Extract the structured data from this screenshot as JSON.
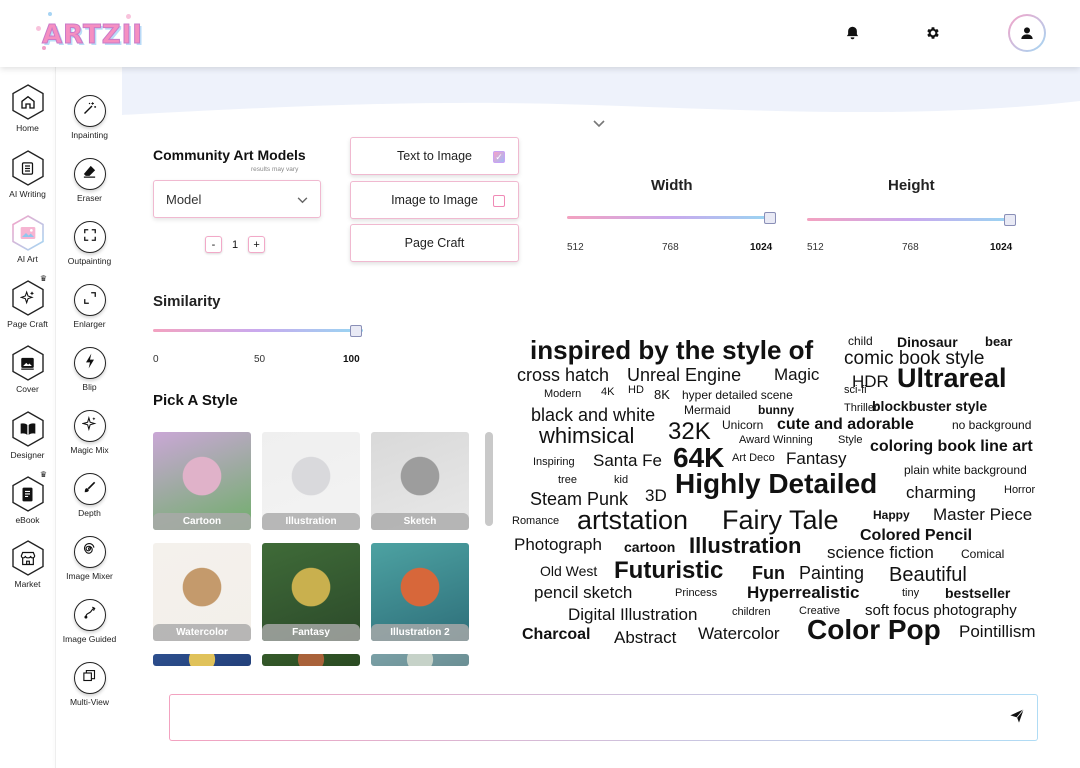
{
  "app": {
    "logo_text": "ARTZII"
  },
  "header": {
    "icons": [
      "bell-icon",
      "gear-icon",
      "user-icon"
    ]
  },
  "rail_primary": [
    {
      "label": "Home",
      "icon": "home-icon"
    },
    {
      "label": "AI Writing",
      "icon": "document-lines-icon"
    },
    {
      "label": "AI Art",
      "icon": "image-icon",
      "active": true
    },
    {
      "label": "Page Craft",
      "icon": "sparkles-icon",
      "crown": true
    },
    {
      "label": "Cover",
      "icon": "gallery-icon"
    },
    {
      "label": "Designer",
      "icon": "book-open-icon"
    },
    {
      "label": "eBook",
      "icon": "ebook-icon",
      "crown": true
    },
    {
      "label": "Market",
      "icon": "store-icon"
    }
  ],
  "rail_tools": [
    {
      "label": "Inpainting",
      "icon": "magic-wand-icon"
    },
    {
      "label": "Eraser",
      "icon": "eraser-icon"
    },
    {
      "label": "Outpainting",
      "icon": "expand-corners-icon"
    },
    {
      "label": "Enlarger",
      "icon": "enlarge-icon"
    },
    {
      "label": "Blip",
      "icon": "lightning-icon"
    },
    {
      "label": "Magic Mix",
      "icon": "sparkle-icon"
    },
    {
      "label": "Depth",
      "icon": "brush-icon"
    },
    {
      "label": "Image Mixer",
      "icon": "spiral-icon"
    },
    {
      "label": "Image Guided",
      "icon": "path-icon"
    },
    {
      "label": "Multi-View",
      "icon": "layers-icon"
    }
  ],
  "models": {
    "title": "Community Art Models",
    "note": "results may vary",
    "select_value": "Model",
    "count": "1",
    "minus": "-",
    "plus": "+"
  },
  "modes": [
    {
      "label": "Text to Image",
      "checked": true,
      "has_checkbox": true
    },
    {
      "label": "Image to Image",
      "checked": false,
      "has_checkbox": true
    },
    {
      "label": "Page Craft",
      "checked": false,
      "has_checkbox": false
    }
  ],
  "width": {
    "label": "Width",
    "min": "512",
    "mid": "768",
    "max": "1024",
    "value": 1024
  },
  "height": {
    "label": "Height",
    "min": "512",
    "mid": "768",
    "max": "1024",
    "value": 1024
  },
  "similarity": {
    "label": "Similarity",
    "min": "0",
    "mid": "50",
    "max": "100",
    "value": 100
  },
  "styles": {
    "title": "Pick A Style",
    "items": [
      {
        "label": "Cartoon",
        "bg": [
          "#caa7d6",
          "#e0b2c9",
          "#6fae6a"
        ]
      },
      {
        "label": "Illustration",
        "bg": [
          "#efefef",
          "#d9d9dc",
          "#f3f3f3"
        ]
      },
      {
        "label": "Sketch",
        "bg": [
          "#d9d9d9",
          "#9d9d9d",
          "#e8e8e8"
        ]
      },
      {
        "label": "Watercolor",
        "bg": [
          "#f4f1ec",
          "#c49a6c",
          "#f3efea"
        ]
      },
      {
        "label": "Fantasy",
        "bg": [
          "#3f6b38",
          "#c9b04e",
          "#2c4a2a"
        ]
      },
      {
        "label": "Illustration 2",
        "bg": [
          "#4da2a2",
          "#d7673a",
          "#2e6f7a"
        ]
      },
      {
        "label": "",
        "bg": [
          "#2d4f8e",
          "#e0c25a",
          "#23407a"
        ]
      },
      {
        "label": "",
        "bg": [
          "#355a2a",
          "#a9623a",
          "#2a4a22"
        ]
      },
      {
        "label": "",
        "bg": [
          "#7aa0a6",
          "#c6d2c8",
          "#6b8f94"
        ]
      }
    ]
  },
  "word_cloud": [
    {
      "t": "inspired by the style of",
      "s": 26,
      "w": 700
    },
    {
      "t": "child",
      "s": 12,
      "w": 400
    },
    {
      "t": "Dinosaur",
      "s": 14,
      "w": 700
    },
    {
      "t": "bear",
      "s": 13,
      "w": 700
    },
    {
      "t": "comic book style",
      "s": 19,
      "w": 400
    },
    {
      "t": "cross hatch",
      "s": 18,
      "w": 400
    },
    {
      "t": "Unreal Engine",
      "s": 18,
      "w": 400
    },
    {
      "t": "Magic",
      "s": 17,
      "w": 400
    },
    {
      "t": "HDR",
      "s": 17,
      "w": 400
    },
    {
      "t": "Ultrareal",
      "s": 27,
      "w": 700
    },
    {
      "t": "Modern",
      "s": 11,
      "w": 400
    },
    {
      "t": "4K",
      "s": 11,
      "w": 400
    },
    {
      "t": "HD",
      "s": 11,
      "w": 400
    },
    {
      "t": "8K",
      "s": 13,
      "w": 400
    },
    {
      "t": "hyper detailed scene",
      "s": 12,
      "w": 400
    },
    {
      "t": "sci-fi",
      "s": 11,
      "w": 400
    },
    {
      "t": "black and white",
      "s": 18,
      "w": 400
    },
    {
      "t": "Mermaid",
      "s": 12,
      "w": 400
    },
    {
      "t": "bunny",
      "s": 12,
      "w": 700
    },
    {
      "t": "Thriller",
      "s": 11,
      "w": 400
    },
    {
      "t": "blockbuster style",
      "s": 14,
      "w": 700
    },
    {
      "t": "whimsical",
      "s": 22,
      "w": 400
    },
    {
      "t": "32K",
      "s": 24,
      "w": 400
    },
    {
      "t": "Unicorn",
      "s": 12,
      "w": 400
    },
    {
      "t": "cute and adorable",
      "s": 16,
      "w": 700
    },
    {
      "t": "no background",
      "s": 12,
      "w": 400
    },
    {
      "t": "Award Winning",
      "s": 11,
      "w": 400
    },
    {
      "t": "Style",
      "s": 11,
      "w": 400
    },
    {
      "t": "coloring book line art",
      "s": 16,
      "w": 700
    },
    {
      "t": "Inspiring",
      "s": 11,
      "w": 400
    },
    {
      "t": "Santa Fe",
      "s": 17,
      "w": 400
    },
    {
      "t": "64K",
      "s": 28,
      "w": 700
    },
    {
      "t": "Art Deco",
      "s": 11,
      "w": 400
    },
    {
      "t": "Fantasy",
      "s": 17,
      "w": 400
    },
    {
      "t": "plain white background",
      "s": 12,
      "w": 400
    },
    {
      "t": "tree",
      "s": 11,
      "w": 400
    },
    {
      "t": "kid",
      "s": 11,
      "w": 400
    },
    {
      "t": "Steam Punk",
      "s": 18,
      "w": 400
    },
    {
      "t": "3D",
      "s": 17,
      "w": 400
    },
    {
      "t": "Highly Detailed",
      "s": 28,
      "w": 700
    },
    {
      "t": "charming",
      "s": 17,
      "w": 400
    },
    {
      "t": "Horror",
      "s": 11,
      "w": 400
    },
    {
      "t": "Romance",
      "s": 11,
      "w": 400
    },
    {
      "t": "artstation",
      "s": 27,
      "w": 400
    },
    {
      "t": "Fairy Tale",
      "s": 27,
      "w": 400
    },
    {
      "t": "Happy",
      "s": 12,
      "w": 700
    },
    {
      "t": "Master Piece",
      "s": 17,
      "w": 400
    },
    {
      "t": "Colored Pencil",
      "s": 16,
      "w": 700
    },
    {
      "t": "Photograph",
      "s": 17,
      "w": 400
    },
    {
      "t": "cartoon",
      "s": 14,
      "w": 700
    },
    {
      "t": "Illustration",
      "s": 22,
      "w": 700
    },
    {
      "t": "science fiction",
      "s": 17,
      "w": 400
    },
    {
      "t": "Comical",
      "s": 12,
      "w": 400
    },
    {
      "t": "Old West",
      "s": 14,
      "w": 400
    },
    {
      "t": "Futuristic",
      "s": 24,
      "w": 700
    },
    {
      "t": "Fun",
      "s": 18,
      "w": 700
    },
    {
      "t": "Painting",
      "s": 18,
      "w": 400
    },
    {
      "t": "Beautiful",
      "s": 20,
      "w": 400
    },
    {
      "t": "pencil sketch",
      "s": 17,
      "w": 400
    },
    {
      "t": "Princess",
      "s": 11,
      "w": 400
    },
    {
      "t": "Hyperrealistic",
      "s": 17,
      "w": 700
    },
    {
      "t": "tiny",
      "s": 11,
      "w": 400
    },
    {
      "t": "bestseller",
      "s": 14,
      "w": 700
    },
    {
      "t": "Digital Illustration",
      "s": 17,
      "w": 400
    },
    {
      "t": "children",
      "s": 11,
      "w": 400
    },
    {
      "t": "Creative",
      "s": 11,
      "w": 400
    },
    {
      "t": "soft focus photography",
      "s": 15,
      "w": 400
    },
    {
      "t": "Charcoal",
      "s": 16,
      "w": 700
    },
    {
      "t": "Abstract",
      "s": 17,
      "w": 400
    },
    {
      "t": "Watercolor",
      "s": 17,
      "w": 400
    },
    {
      "t": "Color Pop",
      "s": 28,
      "w": 700
    },
    {
      "t": "Pointillism",
      "s": 17,
      "w": 400
    }
  ],
  "prompt": {
    "placeholder": "",
    "value": ""
  },
  "colors": {
    "pink": "#f3a2c0",
    "lavender": "#c9a9ee",
    "sky": "#96d8f2"
  }
}
